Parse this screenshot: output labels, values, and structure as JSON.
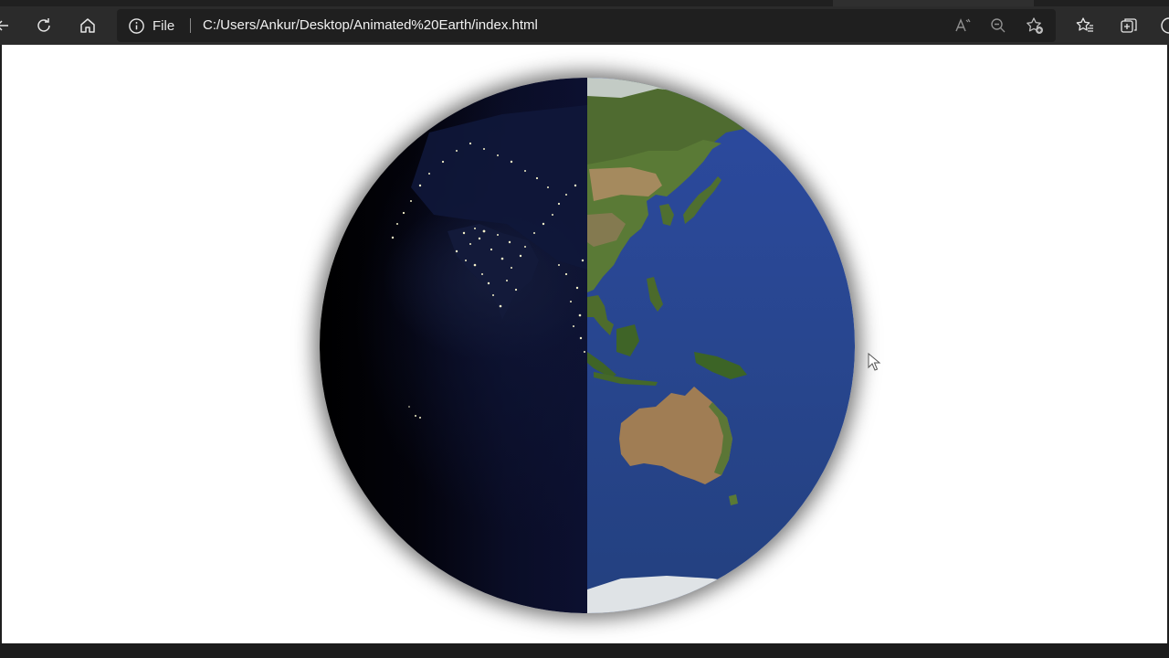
{
  "toolbar": {
    "site_info_label": "File",
    "url": "C:/Users/Ankur/Desktop/Animated%20Earth/index.html"
  },
  "icons": {
    "back": "back-arrow-icon",
    "reload": "reload-icon",
    "home": "home-icon",
    "info": "info-icon",
    "read_aloud": "read-aloud-icon",
    "zoom_out": "zoom-out-icon",
    "add_favorite": "add-favorite-icon",
    "favorites": "favorites-icon",
    "collections": "collections-icon",
    "profile": "profile-icon"
  },
  "colors": {
    "toolbar_bg": "#2b2b2b",
    "omnibox_bg": "#1f1f1f",
    "ocean": "#2a4796",
    "land_green": "#4e6b2f",
    "land_desert": "#a07d54",
    "night": "#05050f",
    "city_lights": "#f3efc8"
  }
}
